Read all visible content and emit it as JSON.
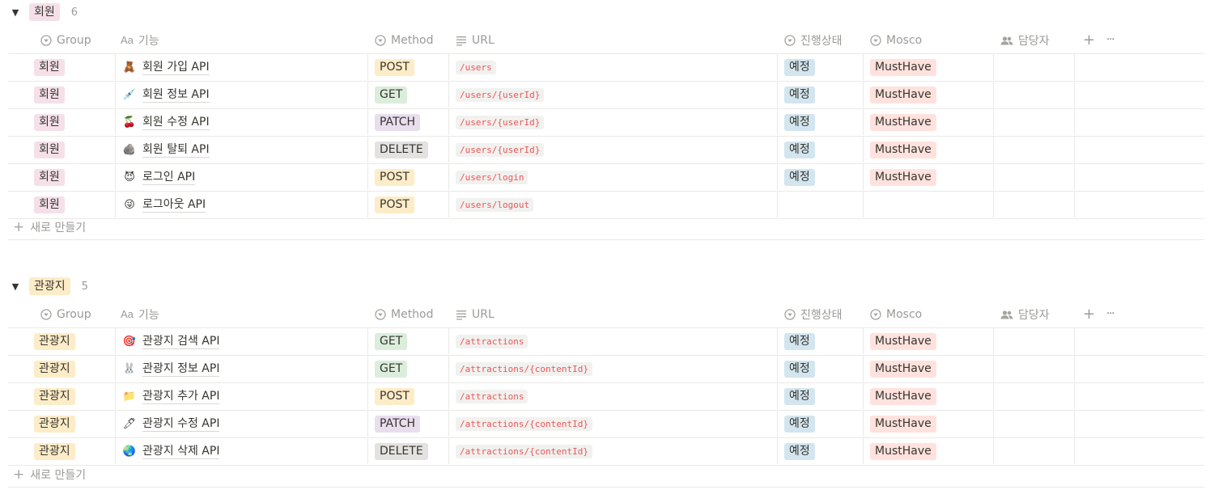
{
  "columns": {
    "group": "Group",
    "feature": "기능",
    "feature_prefix": "Aa",
    "method": "Method",
    "url": "URL",
    "status": "진행상태",
    "mosco": "Mosco",
    "assignee": "담당자",
    "add": "+",
    "more": "···"
  },
  "new_row_label": "새로 만들기",
  "groups": [
    {
      "name": "회원",
      "count": "6",
      "rows": [
        {
          "group": "회원",
          "emoji": "🧸",
          "name": "회원 가입 API",
          "method": "POST",
          "url": "/users",
          "status": "예정",
          "mosco": "MustHave"
        },
        {
          "group": "회원",
          "emoji": "💉",
          "name": "회원 정보 API",
          "method": "GET",
          "url": "/users/{userId}",
          "status": "예정",
          "mosco": "MustHave"
        },
        {
          "group": "회원",
          "emoji": "🍒",
          "name": "회원 수정 API",
          "method": "PATCH",
          "url": "/users/{userId}",
          "status": "예정",
          "mosco": "MustHave"
        },
        {
          "group": "회원",
          "emoji": "🪨",
          "name": "회원 탈퇴 API",
          "method": "DELETE",
          "url": "/users/{userId}",
          "status": "예정",
          "mosco": "MustHave"
        },
        {
          "group": "회원",
          "emoji": "😈",
          "name": "로그인 API",
          "method": "POST",
          "url": "/users/login",
          "status": "예정",
          "mosco": "MustHave"
        },
        {
          "group": "회원",
          "emoji": "😜",
          "name": "로그아웃 API",
          "method": "POST",
          "url": "/users/logout",
          "status": "",
          "mosco": ""
        }
      ]
    },
    {
      "name": "관광지",
      "count": "5",
      "rows": [
        {
          "group": "관광지",
          "emoji": "🎯",
          "name": "관광지 검색 API",
          "method": "GET",
          "url": "/attractions",
          "status": "예정",
          "mosco": "MustHave"
        },
        {
          "group": "관광지",
          "emoji": "🐰",
          "name": "관광지 정보 API",
          "method": "GET",
          "url": "/attractions/{contentId}",
          "status": "예정",
          "mosco": "MustHave"
        },
        {
          "group": "관광지",
          "emoji": "📁",
          "name": "관광지 추가 API",
          "method": "POST",
          "url": "/attractions",
          "status": "예정",
          "mosco": "MustHave"
        },
        {
          "group": "관광지",
          "emoji": "🖊",
          "name": "관광지 수정 API",
          "method": "PATCH",
          "url": "/attractions/{contentId}",
          "status": "예정",
          "mosco": "MustHave"
        },
        {
          "group": "관광지",
          "emoji": "🌏",
          "name": "관광지 삭제 API",
          "method": "DELETE",
          "url": "/attractions/{contentId}",
          "status": "예정",
          "mosco": "MustHave"
        }
      ]
    }
  ],
  "colors": {
    "group_회원": "#f5e0e9",
    "group_관광지": "#fdecc8",
    "method_POST": "#fdecc8",
    "method_GET": "#dbeddb",
    "method_PATCH": "#e8deee",
    "method_DELETE": "#e3e2e0",
    "status": "#d3e5ef",
    "mosco": "#ffe2dd",
    "code_text": "#eb5757"
  },
  "icons": {
    "group": "select-icon",
    "method": "select-icon",
    "url": "text-lines-icon",
    "status": "select-icon",
    "mosco": "select-icon",
    "assignee": "people-icon"
  }
}
